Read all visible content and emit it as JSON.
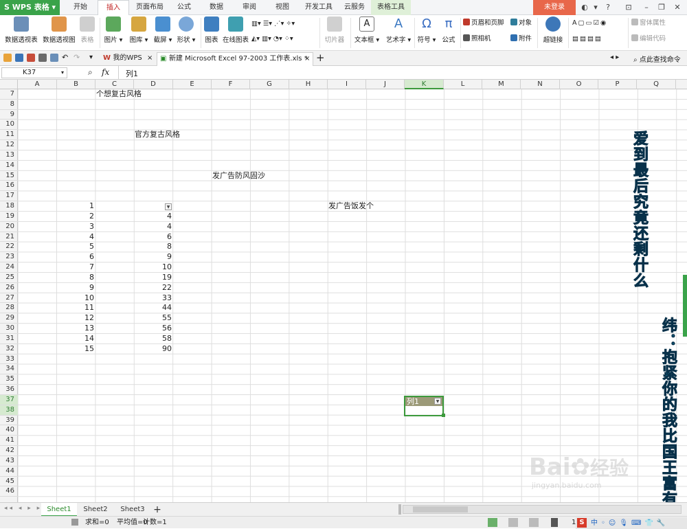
{
  "app": {
    "title": "WPS 表格",
    "login": "未登录",
    "colors": {
      "green": "#3aa34a",
      "login": "#e8674a"
    }
  },
  "menu_tabs": [
    "开始",
    "插入",
    "页面布局",
    "公式",
    "数据",
    "审阅",
    "视图",
    "开发工具",
    "云服务",
    "表格工具"
  ],
  "ribbon": {
    "items": [
      "数据透视表",
      "数据透视图",
      "表格",
      "图片",
      "图库",
      "截屏",
      "形状",
      "图表",
      "在线图表",
      "切片器",
      "文本框",
      "艺术字",
      "符号",
      "公式",
      "超链接"
    ],
    "symbol_glyph": "Ω",
    "formula_glyph": "π",
    "textbox_glyph": "A",
    "small": {
      "header_footer": "页眉和页脚",
      "camera": "照相机",
      "object": "对象",
      "attachment": "附件",
      "properties": "窗体属性",
      "code": "编辑代码"
    }
  },
  "doc_tabs": [
    {
      "label": "我的WPS",
      "close": "×"
    },
    {
      "label": "新建 Microsoft Excel 97-2003 工作表.xls *",
      "close": "×"
    }
  ],
  "find_cmd": "点此查找命令",
  "formula": {
    "cell_ref": "K37",
    "fx": "fx",
    "content": "列1"
  },
  "columns": [
    "A",
    "B",
    "C",
    "D",
    "E",
    "F",
    "G",
    "H",
    "I",
    "J",
    "K",
    "L",
    "M",
    "N",
    "O",
    "P",
    "Q"
  ],
  "rows": [
    "7",
    "8",
    "9",
    "10",
    "11",
    "12",
    "13",
    "14",
    "15",
    "16",
    "17",
    "18",
    "19",
    "20",
    "21",
    "22",
    "23",
    "24",
    "25",
    "26",
    "27",
    "28",
    "29",
    "30",
    "31",
    "32",
    "33",
    "34",
    "35",
    "36",
    "37",
    "38",
    "39",
    "40",
    "41",
    "42",
    "43",
    "44",
    "45",
    "46"
  ],
  "text_cells": {
    "c7": "个想复古风格",
    "d11": "官方复古风格",
    "f15": "发广告防风固沙",
    "i18": "发广告饭发个"
  },
  "col_b": [
    "1",
    "2",
    "3",
    "4",
    "5",
    "6",
    "7",
    "8",
    "9",
    "10",
    "11",
    "12",
    "13",
    "14",
    "15"
  ],
  "col_d": [
    "4",
    "4",
    "6",
    "8",
    "9",
    "10",
    "19",
    "22",
    "33",
    "44",
    "55",
    "56",
    "58",
    "90"
  ],
  "filter_header": "列1",
  "overlay_text": {
    "line1": "爱到最后究竟还剩什么",
    "line2": "纬：抱紧你的我比国王富有"
  },
  "watermark": {
    "brand": "Bai",
    "cn": "经验",
    "url": "jingyan.baidu.com"
  },
  "sheets": [
    "Sheet1",
    "Sheet2",
    "Sheet3"
  ],
  "status": {
    "sum": "求和=0",
    "avg": "平均值=0",
    "count": "计数=1",
    "zoom": "1"
  }
}
